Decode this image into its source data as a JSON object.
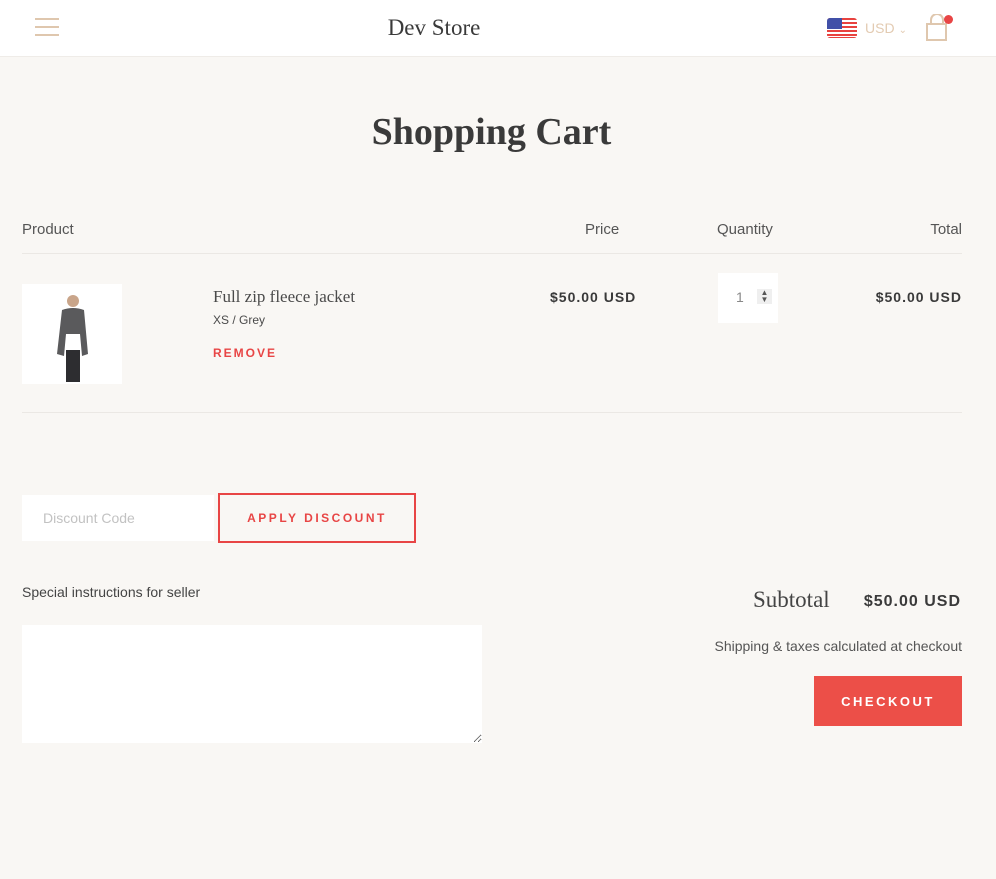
{
  "header": {
    "store_name": "Dev Store",
    "currency": "USD",
    "menu_icon": "hamburger-icon",
    "cart_icon": "shopping-bag-icon",
    "flag_icon": "us-flag-icon",
    "cart_has_items": true
  },
  "page": {
    "title": "Shopping Cart"
  },
  "table": {
    "headers": {
      "product": "Product",
      "price": "Price",
      "quantity": "Quantity",
      "total": "Total"
    },
    "items": [
      {
        "name": "Full zip fleece jacket",
        "variant": "XS / Grey",
        "remove_label": "REMOVE",
        "price": "$50.00 USD",
        "quantity": "1",
        "total": "$50.00 USD"
      }
    ]
  },
  "discount": {
    "placeholder": "Discount Code",
    "value": "",
    "button_label": "APPLY DISCOUNT"
  },
  "instructions": {
    "label": "Special instructions for seller",
    "value": ""
  },
  "summary": {
    "subtotal_label": "Subtotal",
    "subtotal_value": "$50.00 USD",
    "shipping_note": "Shipping & taxes calculated at checkout",
    "checkout_label": "CHECKOUT"
  },
  "colors": {
    "accent": "#e84545",
    "checkout_bg": "#ec4f48",
    "header_icon": "#dfc7ae",
    "background": "#f9f7f4"
  }
}
